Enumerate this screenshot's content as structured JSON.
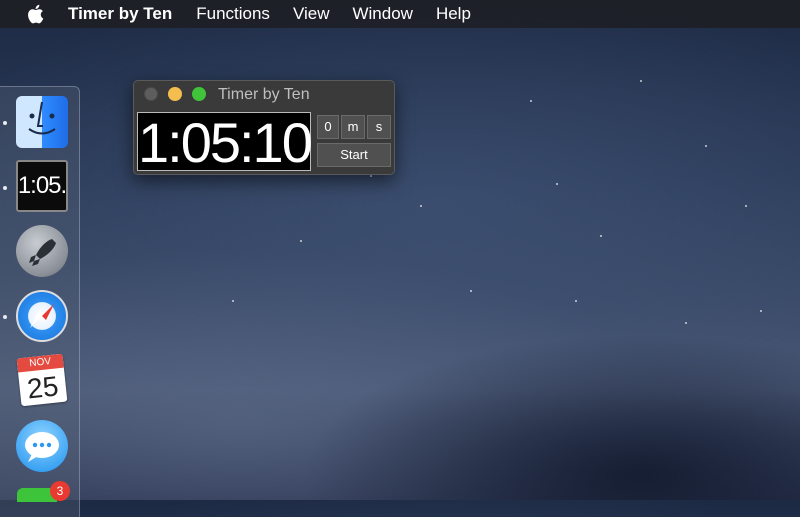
{
  "menubar": {
    "apple_icon": "apple-logo-icon",
    "app_name": "Timer by Ten",
    "items": [
      "Functions",
      "View",
      "Window",
      "Help"
    ]
  },
  "window": {
    "title": "Timer by Ten",
    "time_display": "1:05:10",
    "segments": [
      "0",
      "m",
      "s"
    ],
    "start_label": "Start"
  },
  "dock": {
    "icons": [
      "finder-icon",
      "timer-by-ten-icon",
      "launchpad-icon",
      "safari-icon",
      "calendar-icon",
      "messages-icon",
      "facetime-icon"
    ],
    "timer_icon_text": "1:05.",
    "calendar_month": "NOV",
    "calendar_day": "25",
    "badge_count": "3"
  },
  "colors": {
    "close_light": "#5d5d5d",
    "minimize_light": "#f4be4f",
    "maximize_light": "#3fc43a",
    "badge": "#e83a30"
  }
}
